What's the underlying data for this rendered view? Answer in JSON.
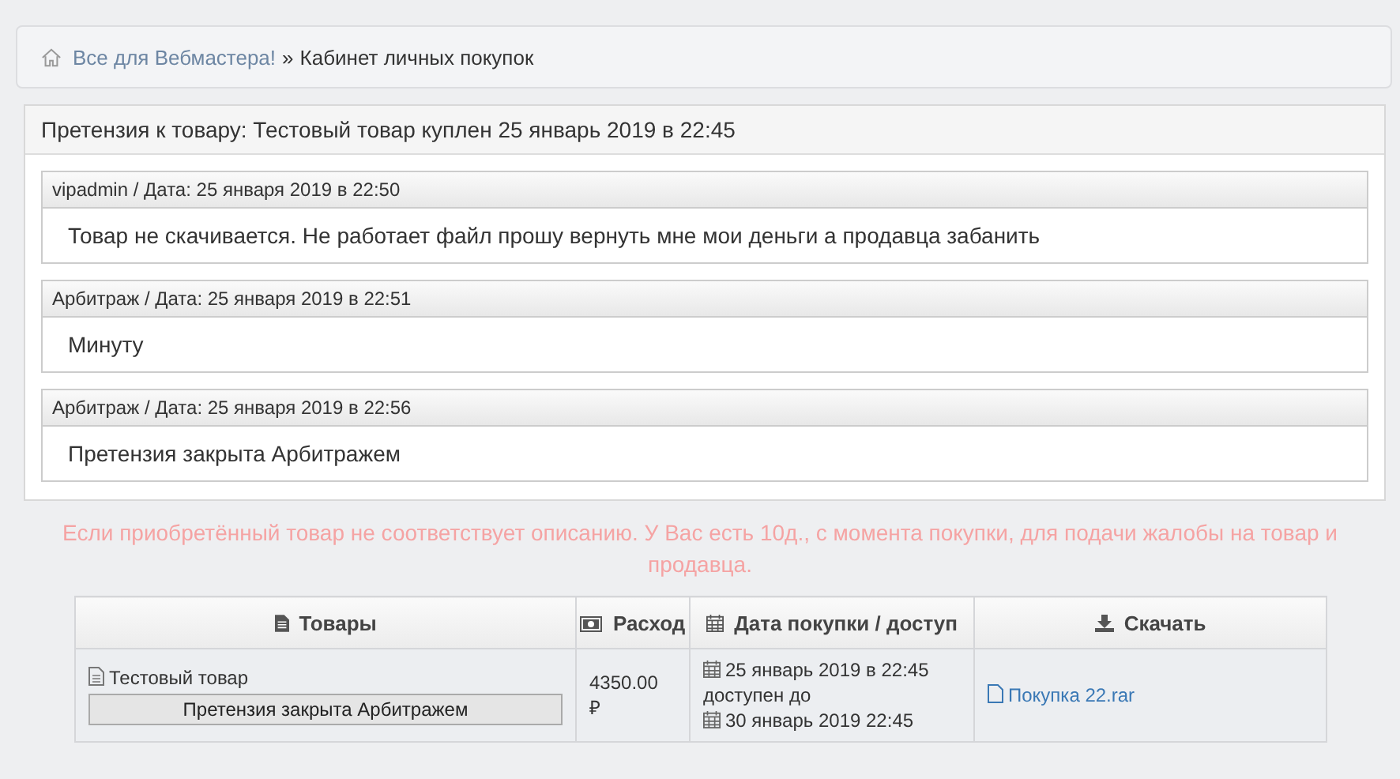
{
  "breadcrumb": {
    "home": "Все для Вебмастера!",
    "separator": "»",
    "current": "Кабинет личных покупок"
  },
  "claim": {
    "title": "Претензия к товару: Тестовый товар куплен 25 январь 2019 в 22:45",
    "messages": [
      {
        "header": "vipadmin / Дата: 25 января 2019 в 22:50",
        "text": "Товар не скачивается. Не работает файл прошу вернуть мне мои деньги а продавца забанить"
      },
      {
        "header": "Арбитраж / Дата: 25 января 2019 в 22:51",
        "text": "Минуту"
      },
      {
        "header": "Арбитраж / Дата: 25 января 2019 в 22:56",
        "text": "Претензия закрыта Арбитражем"
      }
    ]
  },
  "notice": "Если приобретённый товар не соответствует описанию. У Вас есть 10д., с момента покупки, для подачи жалобы на товар и продавца.",
  "table": {
    "columns": [
      {
        "kind": "file",
        "label": "Товары"
      },
      {
        "kind": "money",
        "label": "Расход"
      },
      {
        "kind": "calendar",
        "label": "Дата покупки / доступ"
      },
      {
        "kind": "download",
        "label": "Скачать"
      }
    ],
    "rows": [
      {
        "product": "Тестовый товар",
        "claim_button": "Претензия закрыта Арбитражем",
        "cost": "4350.00",
        "currency": "₽",
        "purchased": "25 январь 2019 в 22:45",
        "access_label": "доступен до",
        "access_until": "30 январь 2019 22:45",
        "download": "Покупка 22.rar"
      }
    ]
  }
}
